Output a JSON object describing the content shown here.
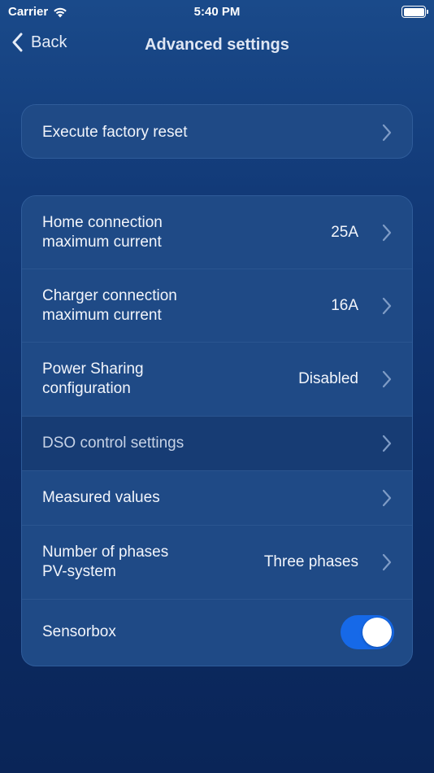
{
  "status_bar": {
    "carrier": "Carrier",
    "time": "5:40 PM"
  },
  "nav": {
    "back_label": "Back",
    "title": "Advanced settings"
  },
  "factory_reset": {
    "label": "Execute factory reset"
  },
  "settings": {
    "home_connection": {
      "label_line1": "Home connection",
      "label_line2": "maximum current",
      "value": "25A"
    },
    "charger_connection": {
      "label_line1": "Charger connection",
      "label_line2": "maximum current",
      "value": "16A"
    },
    "power_sharing": {
      "label_line1": "Power Sharing",
      "label_line2": "configuration",
      "value": "Disabled"
    },
    "dso_control": {
      "label": "DSO control settings"
    },
    "measured_values": {
      "label": "Measured values"
    },
    "phases": {
      "label_line1": "Number of phases",
      "label_line2": "PV-system",
      "value": "Three phases"
    },
    "sensorbox": {
      "label": "Sensorbox",
      "enabled": true
    }
  },
  "colors": {
    "accent": "#1669e8",
    "card": "#1f4a86",
    "background": "#0d2d66"
  },
  "icons": [
    "wifi-icon",
    "battery-icon",
    "back-chevron-icon",
    "chevron-right-icon"
  ]
}
